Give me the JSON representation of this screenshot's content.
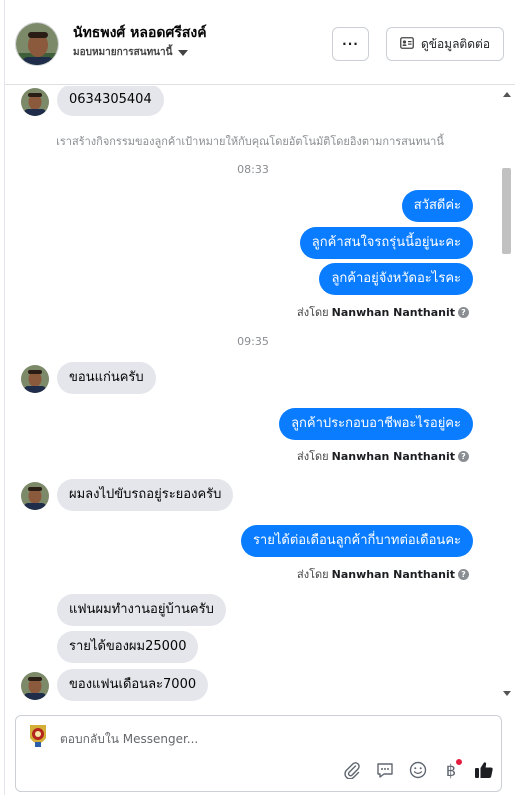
{
  "header": {
    "contact_name": "นัทธพงศ์ หลอดศรีสงค์",
    "assign_label": "มอบหมายการสนทนานี้",
    "more_label": "···",
    "contact_info_label": "ดูข้อมูลติดต่อ"
  },
  "thread": {
    "phone_message": "0634305404",
    "system_note": "เราสร้างกิจกรรมของลูกค้าเป้าหมายให้กับคุณโดยอัตโนมัติโดยอิงตามการสนทนานี้",
    "time_1": "08:33",
    "out_1": "สวัสดีค่ะ",
    "out_2": "ลูกค้าสนใจรถรุ่นนี้อยู่นะคะ",
    "out_3": "ลูกค้าอยู่จังหวัดอะไรคะ",
    "sent_by_prefix": "ส่งโดย",
    "sender_name": "Nanwhan Nanthanit",
    "time_2": "09:35",
    "in_1": "ขอนแก่นครับ",
    "out_4": "ลูกค้าประกอบอาชีพอะไรอยู่คะ",
    "in_2": "ผมลงไปขับรถอยู่ระยองครับ",
    "out_5": "รายได้ต่อเดือนลูกค้ากี่บาทต่อเดือนคะ",
    "in_3": "แฟนผมทำงานอยู่บ้านครับ",
    "in_4": "รายได้ของผม25000",
    "in_5": "ของแฟนเดือนละ7000"
  },
  "composer": {
    "placeholder": "ตอบกลับใน Messenger..."
  },
  "colors": {
    "outgoing_bubble": "#0a7cff",
    "incoming_bubble": "#e4e6eb",
    "accent": "#1877f2"
  },
  "icons": [
    "more-icon",
    "contact-card-icon",
    "caret-down-icon",
    "attachment-icon",
    "saved-reply-icon",
    "emoji-icon",
    "baht-payment-icon",
    "like-icon",
    "help-icon"
  ]
}
